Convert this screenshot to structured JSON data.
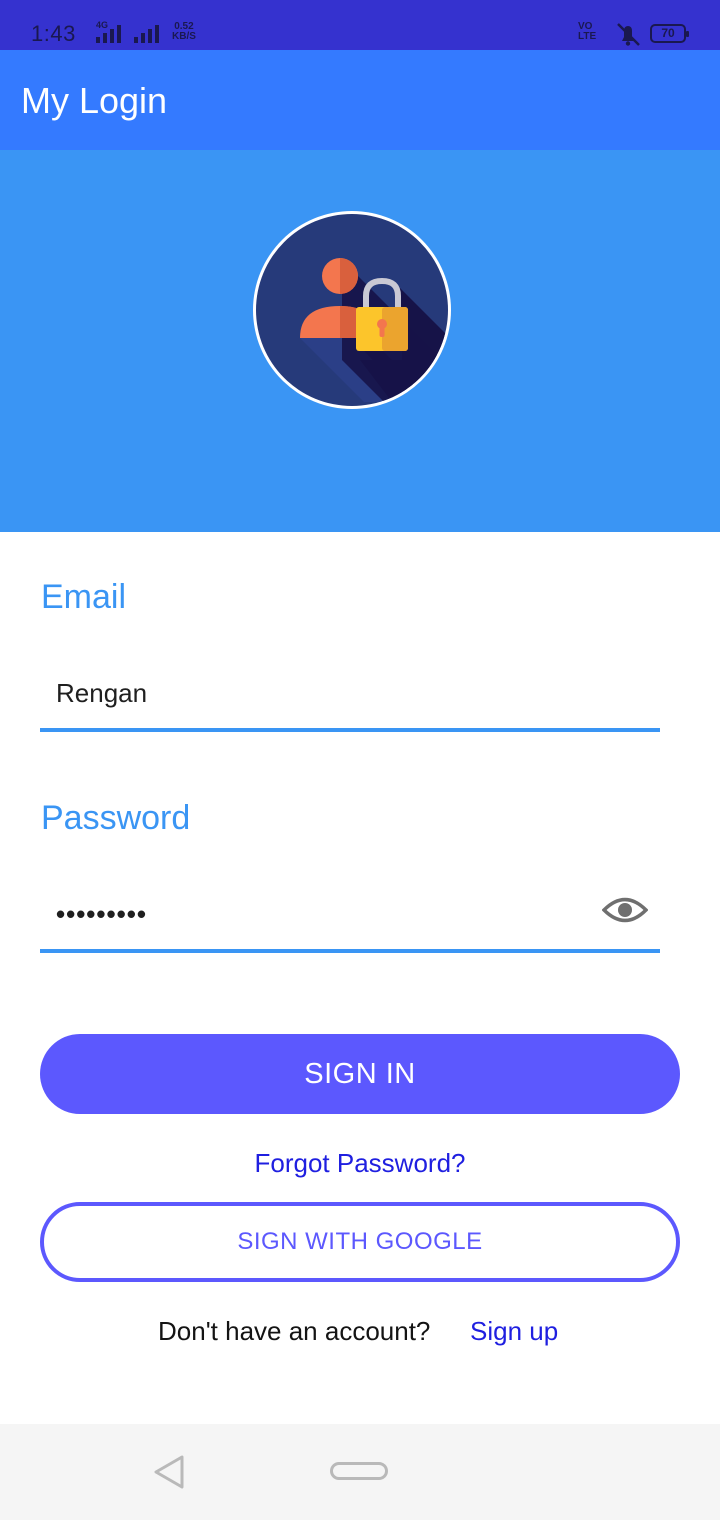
{
  "status_bar": {
    "time": "1:43",
    "network_label": "4G",
    "speed_value": "0.52",
    "speed_unit": "KB/S",
    "volte_line1": "VO",
    "volte_line2": "LTE",
    "battery_level": "70"
  },
  "app_bar": {
    "title": "My Login"
  },
  "hero": {
    "logo_icon": "user-lock-icon"
  },
  "form": {
    "email_label": "Email",
    "email_value": "Rengan",
    "password_label": "Password",
    "password_value": "•••••••••",
    "password_toggle_icon": "eye-icon"
  },
  "actions": {
    "sign_in_label": "SIGN IN",
    "forgot_password_label": "Forgot Password?",
    "google_label": "SIGN WITH GOOGLE",
    "signup_prompt": "Don't have an account?",
    "signup_link": "Sign up"
  },
  "nav_bar": {
    "back_icon": "back-triangle-icon",
    "home_icon": "home-pill-icon"
  },
  "colors": {
    "status_bar": "#3532cf",
    "app_bar": "#347aff",
    "hero": "#3a95f4",
    "accent": "#3a95f4",
    "button": "#5c58fe",
    "link": "#1f1fe0"
  }
}
